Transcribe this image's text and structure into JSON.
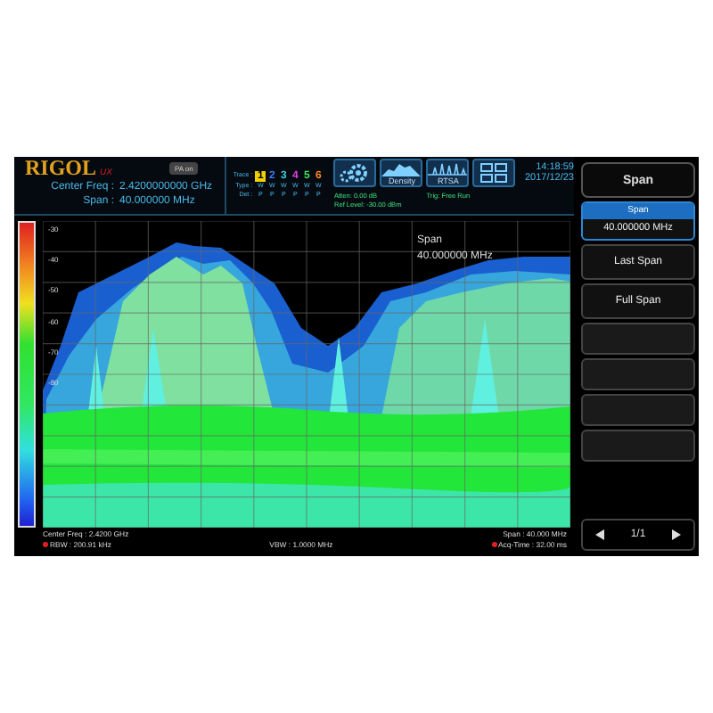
{
  "brand": {
    "logo": "RIGOL",
    "model": "UX"
  },
  "header": {
    "center_label": "Center Freq :",
    "center_value": "2.4200000000 GHz",
    "span_label": "Span :",
    "span_value": "40.000000 MHz",
    "pa_label": "PA on"
  },
  "trace_rows": {
    "trace": "Trace :",
    "type": "Type :",
    "det": "Det :"
  },
  "traces": [
    {
      "label": "1",
      "color": "#f0d000",
      "selected": true,
      "type": "W",
      "det": "P"
    },
    {
      "label": "2",
      "color": "#3a7bff",
      "selected": false,
      "type": "W",
      "det": "P"
    },
    {
      "label": "3",
      "color": "#36d0e0",
      "selected": false,
      "type": "W",
      "det": "P"
    },
    {
      "label": "4",
      "color": "#e040e0",
      "selected": false,
      "type": "W",
      "det": "P"
    },
    {
      "label": "5",
      "color": "#40e060",
      "selected": false,
      "type": "W",
      "det": "P"
    },
    {
      "label": "6",
      "color": "#ff8a20",
      "selected": false,
      "type": "W",
      "det": "P"
    }
  ],
  "settings": {
    "atten": "Atten: 0.00 dB",
    "ref_level": "Ref Level: -30.00 dBm",
    "trig": "Trig: Free Run"
  },
  "toolbar": [
    {
      "kind": "settings"
    },
    {
      "kind": "density",
      "label": "Density"
    },
    {
      "kind": "rtsa",
      "label": "RTSA"
    },
    {
      "kind": "layout"
    }
  ],
  "clock": {
    "time": "14:18:59",
    "date": "2017/12/23"
  },
  "plot": {
    "y_labels": [
      "-30",
      "-40",
      "-50",
      "-60",
      "-70",
      "-80"
    ],
    "marker_label": "Span",
    "marker_value": "40.000000 MHz"
  },
  "footer": {
    "center": "Center Freq : 2.4200 GHz",
    "rbw": {
      "text": "RBW : 200.91 kHz",
      "manual": true
    },
    "vbw": "VBW : 1.0000 MHz",
    "span": "Span : 40.000 MHz",
    "acq": {
      "text": "Acq-Time : 32.00 ms",
      "manual": true
    }
  },
  "menu": {
    "title": "Span",
    "items": [
      {
        "kind": "value",
        "label": "Span",
        "value": "40.000000 MHz",
        "selected": true
      },
      {
        "kind": "button",
        "label": "Last Span",
        "selected": false
      },
      {
        "kind": "button",
        "label": "Full Span",
        "selected": false
      },
      {
        "kind": "empty"
      },
      {
        "kind": "empty"
      },
      {
        "kind": "empty"
      },
      {
        "kind": "empty"
      }
    ],
    "page": "1/1"
  }
}
